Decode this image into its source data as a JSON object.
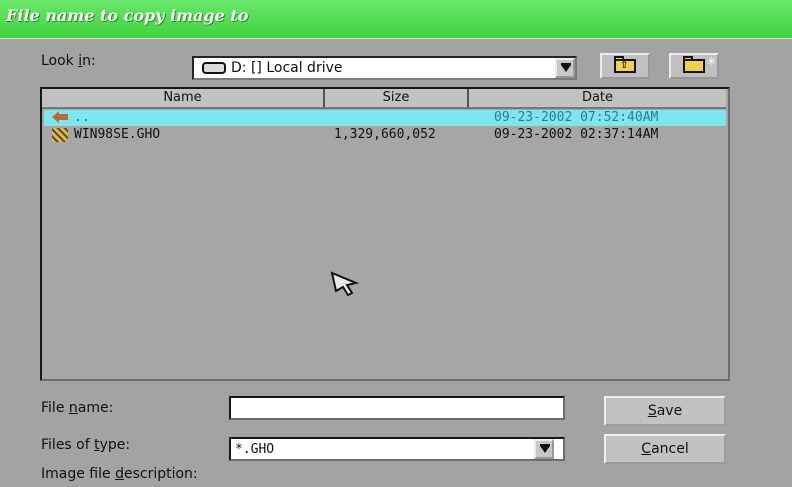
{
  "window": {
    "title": "File name to copy image to"
  },
  "lookin": {
    "label_u": "i",
    "label_pre": "Look ",
    "label_post": "n:",
    "drive_text": "D: [] Local drive"
  },
  "columns": {
    "name": "Name",
    "size": "Size",
    "date": "Date"
  },
  "rows": [
    {
      "name": "..",
      "size": "",
      "date": "09-23-2002 07:52:40AM",
      "selected": true
    },
    {
      "name": "WIN98SE.GHO",
      "size": "1,329,660,052",
      "date": "09-23-2002 02:37:14AM",
      "selected": false
    }
  ],
  "filename": {
    "label_pre": "File ",
    "label_u": "n",
    "label_post": "ame:",
    "value": ""
  },
  "filetype": {
    "label_pre": "Files of ",
    "label_u": "t",
    "label_post": "ype:",
    "value": "*.GHO"
  },
  "description": {
    "label_pre": "Image file ",
    "label_u": "d",
    "label_post": "escription:"
  },
  "buttons": {
    "save_u": "S",
    "save_rest": "ave",
    "cancel_u": "C",
    "cancel_rest": "ancel"
  },
  "colors": {
    "titlebar": "#4fdc4f",
    "dialog": "#a3a3a3",
    "selection": "#7ee6ee"
  },
  "icons": {
    "lookin_drive": "hard-drive-icon",
    "up_folder": "up-one-level-icon",
    "new_folder": "new-folder-icon",
    "parent_row": "parent-folder-icon",
    "file_row": "ghost-image-file-icon"
  }
}
